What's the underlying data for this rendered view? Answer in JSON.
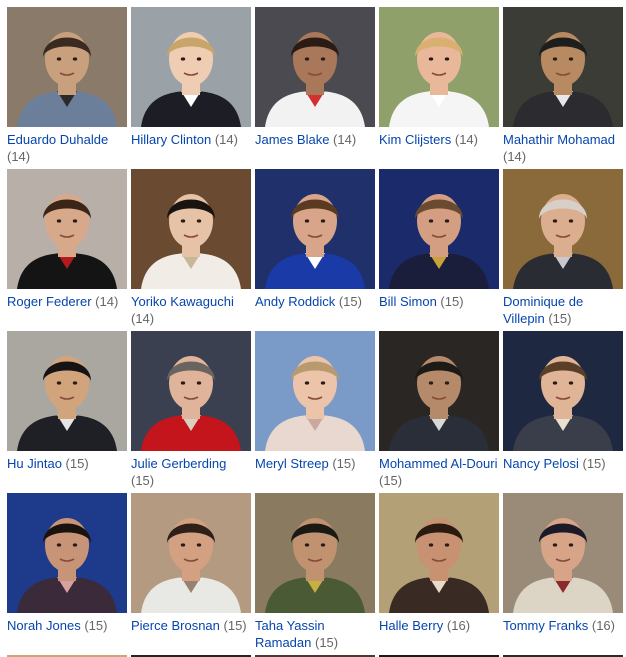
{
  "people": [
    {
      "name": "Eduardo Duhalde",
      "count": "(14)",
      "bg": "#8a7a6a",
      "skin": "#c9a07e",
      "hair": "#3a2a20",
      "shirt": "#6b7f9a",
      "accent": "#2a2a2a"
    },
    {
      "name": "Hillary Clinton",
      "count": "(14)",
      "bg": "#9aa2a8",
      "skin": "#efcdb2",
      "hair": "#c8a56a",
      "shirt": "#1d1d26",
      "accent": "#ffffff"
    },
    {
      "name": "James Blake",
      "count": "(14)",
      "bg": "#4a4a50",
      "skin": "#a9785a",
      "hair": "#2a1c14",
      "shirt": "#f2f2f2",
      "accent": "#d33030"
    },
    {
      "name": "Kim Clijsters",
      "count": "(14)",
      "bg": "#8fa06a",
      "skin": "#e9b89a",
      "hair": "#d9b070",
      "shirt": "#f5f5f5",
      "accent": "#ffffff"
    },
    {
      "name": "Mahathir Mohamad",
      "count": "(14)",
      "bg": "#3c3c36",
      "skin": "#b88a62",
      "hair": "#1e1e1e",
      "shirt": "#2b2b30",
      "accent": "#e8e8e8"
    },
    {
      "name": "Roger Federer",
      "count": "(14)",
      "bg": "#b8b0a8",
      "skin": "#d7a98a",
      "hair": "#3b2418",
      "shirt": "#141414",
      "accent": "#b01c1c"
    },
    {
      "name": "Yoriko Kawaguchi",
      "count": "(14)",
      "bg": "#6a4a30",
      "skin": "#e6c2a6",
      "hair": "#1a1410",
      "shirt": "#f1ede6",
      "accent": "#c8b69a"
    },
    {
      "name": "Andy Roddick",
      "count": "(15)",
      "bg": "#20306a",
      "skin": "#d8a48a",
      "hair": "#5a3a20",
      "shirt": "#1a3aa8",
      "accent": "#ffffff"
    },
    {
      "name": "Bill Simon",
      "count": "(15)",
      "bg": "#1a2a6a",
      "skin": "#d49e82",
      "hair": "#6a4a30",
      "shirt": "#1a1e3a",
      "accent": "#c9a23a"
    },
    {
      "name": "Dominique de Villepin",
      "count": "(15)",
      "bg": "#8a6a3a",
      "skin": "#dcae90",
      "hair": "#d8d0c8",
      "shirt": "#2a2c34",
      "accent": "#c8c8d0"
    },
    {
      "name": "Hu Jintao",
      "count": "(15)",
      "bg": "#aaa6a0",
      "skin": "#d2a47c",
      "hair": "#141414",
      "shirt": "#1e2026",
      "accent": "#e6e6e6"
    },
    {
      "name": "Julie Gerberding",
      "count": "(15)",
      "bg": "#3a4050",
      "skin": "#dfb49a",
      "hair": "#6a6460",
      "shirt": "#c4141c",
      "accent": "#d8d0c0"
    },
    {
      "name": "Meryl Streep",
      "count": "(15)",
      "bg": "#7a9ac8",
      "skin": "#ecc4aa",
      "hair": "#b89a70",
      "shirt": "#e8d8d0",
      "accent": "#caa8a0"
    },
    {
      "name": "Mohammed Al-Douri",
      "count": "(15)",
      "bg": "#2a2624",
      "skin": "#b58a6a",
      "hair": "#1e1a18",
      "shirt": "#2a2e38",
      "accent": "#d8d8d8"
    },
    {
      "name": "Nancy Pelosi",
      "count": "(15)",
      "bg": "#1e2840",
      "skin": "#e0b496",
      "hair": "#5a3e28",
      "shirt": "#3a3e4a",
      "accent": "#e8e0d0"
    },
    {
      "name": "Norah Jones",
      "count": "(15)",
      "bg": "#1e3a8a",
      "skin": "#c89478",
      "hair": "#1a120e",
      "shirt": "#3a2a3a",
      "accent": "#d8a0a0"
    },
    {
      "name": "Pierce Brosnan",
      "count": "(15)",
      "bg": "#b49a80",
      "skin": "#d4a082",
      "hair": "#2e2018",
      "shirt": "#e8e8e4",
      "accent": "#9a8070"
    },
    {
      "name": "Taha Yassin Ramadan",
      "count": "(15)",
      "bg": "#8a7a60",
      "skin": "#c09270",
      "hair": "#1a1a14",
      "shirt": "#4a5a34",
      "accent": "#c8b040"
    },
    {
      "name": "Halle Berry",
      "count": "(16)",
      "bg": "#b4a076",
      "skin": "#c89272",
      "hair": "#2a1a10",
      "shirt": "#3a2a24",
      "accent": "#e8dcc8"
    },
    {
      "name": "Tommy Franks",
      "count": "(16)",
      "bg": "#9a8a78",
      "skin": "#d8a488",
      "hair": "#1a1a28",
      "shirt": "#dcd4c4",
      "accent": "#8a2a2a"
    }
  ],
  "bottom_strip_colors": [
    "#c8a878",
    "#2a2420",
    "#4a3a30",
    "#1a1a1a",
    "#2a2a2a"
  ]
}
